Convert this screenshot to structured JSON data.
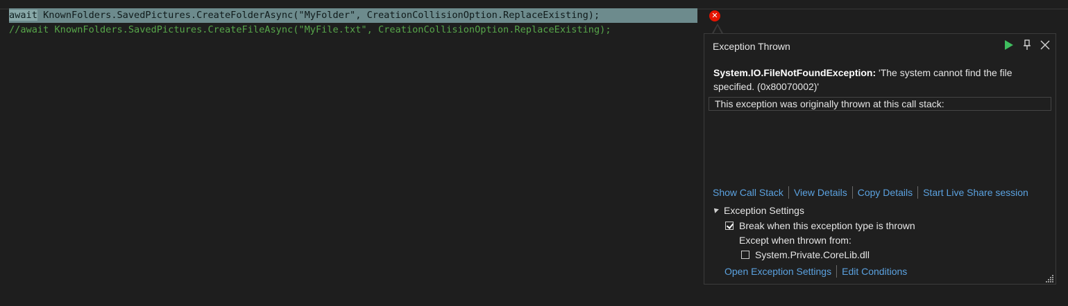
{
  "editor": {
    "line1": {
      "await": "await",
      "rest": " KnownFolders.SavedPictures.CreateFolderAsync(\"MyFolder\", CreationCollisionOption.ReplaceExisting);"
    },
    "line2": "//await KnownFolders.SavedPictures.CreateFileAsync(\"MyFile.txt\", CreationCollisionOption.ReplaceExisting);",
    "error_glyph": "close-icon"
  },
  "popup": {
    "title": "Exception Thrown",
    "exception_type": "System.IO.FileNotFoundException:",
    "exception_message": " 'The system cannot find the file specified. (0x80070002)'",
    "stack_header": "This exception was originally thrown at this call stack:",
    "links": {
      "show_call_stack": "Show Call Stack",
      "view_details": "View Details",
      "copy_details": "Copy Details",
      "live_share": "Start Live Share session"
    },
    "settings": {
      "header": "Exception Settings",
      "break_label": "Break when this exception type is thrown",
      "break_checked": true,
      "except_label": "Except when thrown from:",
      "corelib_label": "System.Private.CoreLib.dll",
      "corelib_checked": false
    },
    "bottom_links": {
      "open_settings": "Open Exception Settings",
      "edit_conditions": "Edit Conditions"
    }
  },
  "colors": {
    "background": "#1e1e1e",
    "selection": "#6d8b8d",
    "comment": "#57a64a",
    "link": "#5ba2e0",
    "error": "#e51400",
    "continue_green": "#3fbf5f"
  }
}
